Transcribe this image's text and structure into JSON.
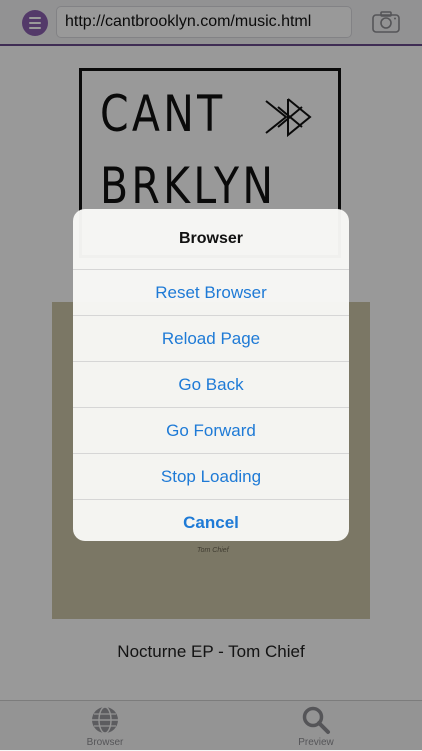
{
  "header": {
    "url": "http://cantbrooklyn.com/music.html",
    "menu_icon": "hamburger-menu-icon",
    "camera_icon": "camera-icon"
  },
  "page": {
    "logo_line1": "CANT",
    "logo_line2": "BRKLYN",
    "album_signature": "Tom Chief",
    "album_caption": "Nocturne EP - Tom Chief"
  },
  "action_sheet": {
    "title": "Browser",
    "items": [
      {
        "label": "Reset Browser"
      },
      {
        "label": "Reload Page"
      },
      {
        "label": "Go Back"
      },
      {
        "label": "Go Forward"
      },
      {
        "label": "Stop Loading"
      },
      {
        "label": "Cancel"
      }
    ]
  },
  "tabbar": {
    "tabs": [
      {
        "label": "Browser",
        "icon": "globe-icon"
      },
      {
        "label": "Preview",
        "icon": "magnifier-icon"
      }
    ]
  },
  "colors": {
    "accent_purple": "#8a5fb0",
    "action_blue": "#1e7ad6",
    "album_paper": "#cdc6a9"
  }
}
